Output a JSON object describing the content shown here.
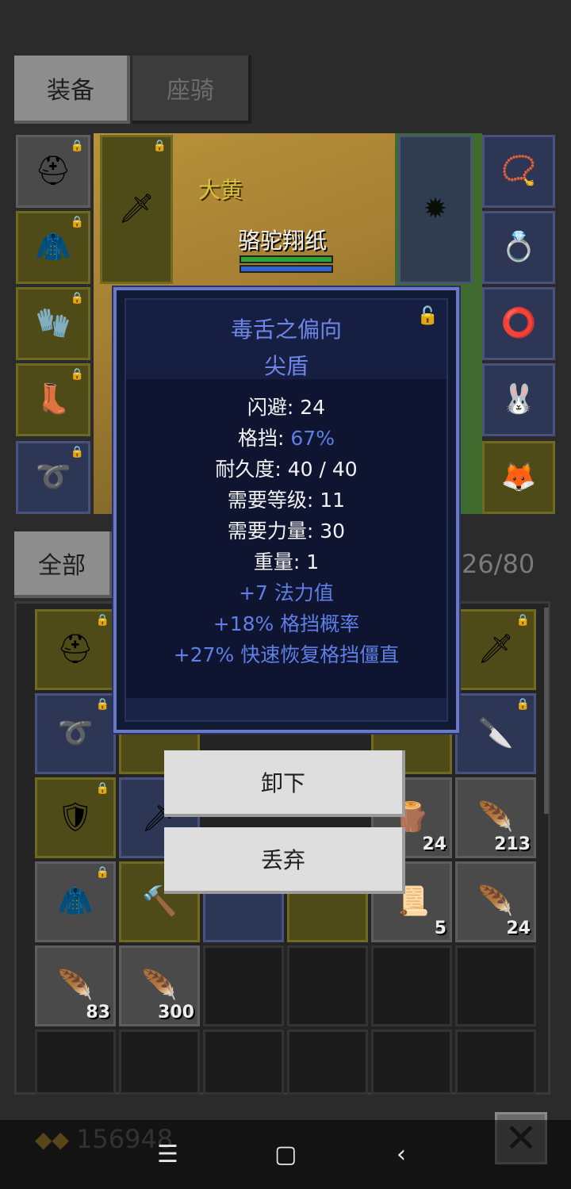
{
  "tabs": {
    "equipment": "装备",
    "mount": "座骑"
  },
  "scene": {
    "pet_name": "大黄",
    "player_name": "骆驼翔纸",
    "hp_fraction": 1.0,
    "mp_fraction": 1.0
  },
  "equip_slots": [
    {
      "name": "helmet",
      "icon": "helmet-icon"
    },
    {
      "name": "chest",
      "icon": "armor-icon"
    },
    {
      "name": "gloves",
      "icon": "gloves-icon"
    },
    {
      "name": "boots",
      "icon": "boots-icon"
    },
    {
      "name": "belt",
      "icon": "belt-icon"
    },
    {
      "name": "weapon",
      "icon": "sword-icon"
    },
    {
      "name": "offhand",
      "icon": "spiked-shield-icon"
    },
    {
      "name": "amulet",
      "icon": "amulet-icon"
    },
    {
      "name": "ring1",
      "icon": "ring-icon"
    },
    {
      "name": "ring2",
      "icon": "ring-icon"
    },
    {
      "name": "pet1",
      "icon": "pet-portrait-icon"
    },
    {
      "name": "pet2",
      "icon": "pet-portrait-icon"
    }
  ],
  "inventory": {
    "filter_label": "全部",
    "capacity": "26/80",
    "counts": {
      "c1": "24",
      "c2": "213",
      "c3": "5",
      "c4": "24",
      "c5": "83",
      "c6": "300"
    }
  },
  "tooltip": {
    "name": "毒舌之偏向",
    "type": "尖盾",
    "stats": {
      "dodge": "闪避: 24",
      "block_label": "格挡: ",
      "block_value": "67%",
      "durability": "耐久度: 40 / 40",
      "req_level": "需要等级: 11",
      "req_str": "需要力量: 30",
      "weight": "重量: 1"
    },
    "affixes": {
      "a1": "+7 法力值",
      "a2": "+18% 格挡概率",
      "a3": "+27% 快速恢复格挡僵直"
    }
  },
  "actions": {
    "unequip": "卸下",
    "discard": "丢弃"
  },
  "gold": "156948",
  "colors": {
    "tooltip_blue": "#6e86e8",
    "affix_blue": "#5d7fe6"
  }
}
